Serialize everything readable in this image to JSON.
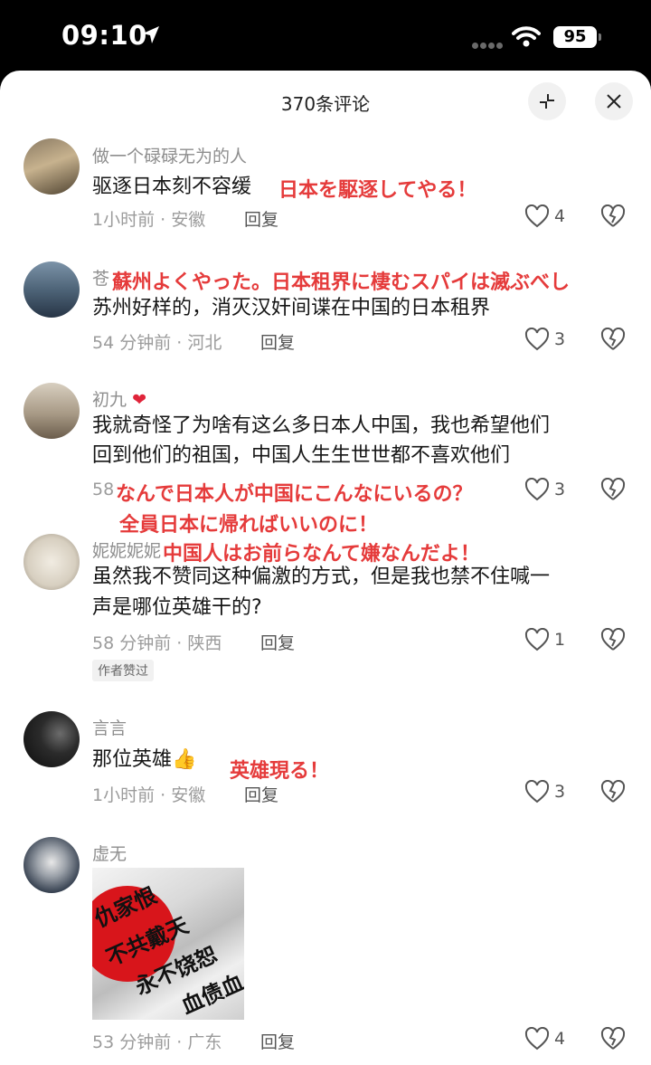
{
  "status_bar": {
    "time": "09:10",
    "battery": "95"
  },
  "header": {
    "title": "370条评论"
  },
  "comments": [
    {
      "user": "做一个碌碌无为的人",
      "text": "驱逐日本刻不容缓",
      "meta": "1小时前 · 安徽",
      "reply": "回复",
      "likes": "4",
      "overlay": "日本を駆逐してやる！"
    },
    {
      "user": "苍",
      "text": "苏州好样的，消灭汉奸间谍在中国的日本租界",
      "meta": "54 分钟前 · 河北",
      "reply": "回复",
      "likes": "3",
      "overlay": "蘇州よくやった。日本租界に棲むスパイは滅ぶべし"
    },
    {
      "user": "初九",
      "text_line1": "我就奇怪了为啥有这么多日本人中国，我也希望他们",
      "text_line2": "回到他们的祖国，中国人生生世世都不喜欢他们",
      "meta": "58",
      "likes": "3",
      "overlay1": "なんで日本人が中国にこんなにいるの？",
      "overlay2": "全員日本に帰ればいいのに！",
      "overlay3": "中国人はお前らなんて嫌なんだよ！"
    },
    {
      "user": "妮妮妮妮",
      "text_line1": "虽然我不赞同这种偏激的方式，但是我也禁不住喊一",
      "text_line2": "声是哪位英雄干的?",
      "meta": "58 分钟前 · 陕西",
      "reply": "回复",
      "likes": "1",
      "badge": "作者赞过"
    },
    {
      "user": "言言",
      "text": "那位英雄",
      "meta": "1小时前 · 安徽",
      "reply": "回复",
      "likes": "3",
      "overlay": "英雄現る！"
    },
    {
      "user": "虚无",
      "image_text": [
        "仇家恨",
        "不共戴天",
        "永不饶恕",
        "血债血"
      ],
      "meta": "53 分钟前 · 广东",
      "reply": "回复",
      "likes": "4"
    }
  ],
  "colors": {
    "overlay_red": "#e53b3b",
    "muted": "#9b9b9b"
  }
}
